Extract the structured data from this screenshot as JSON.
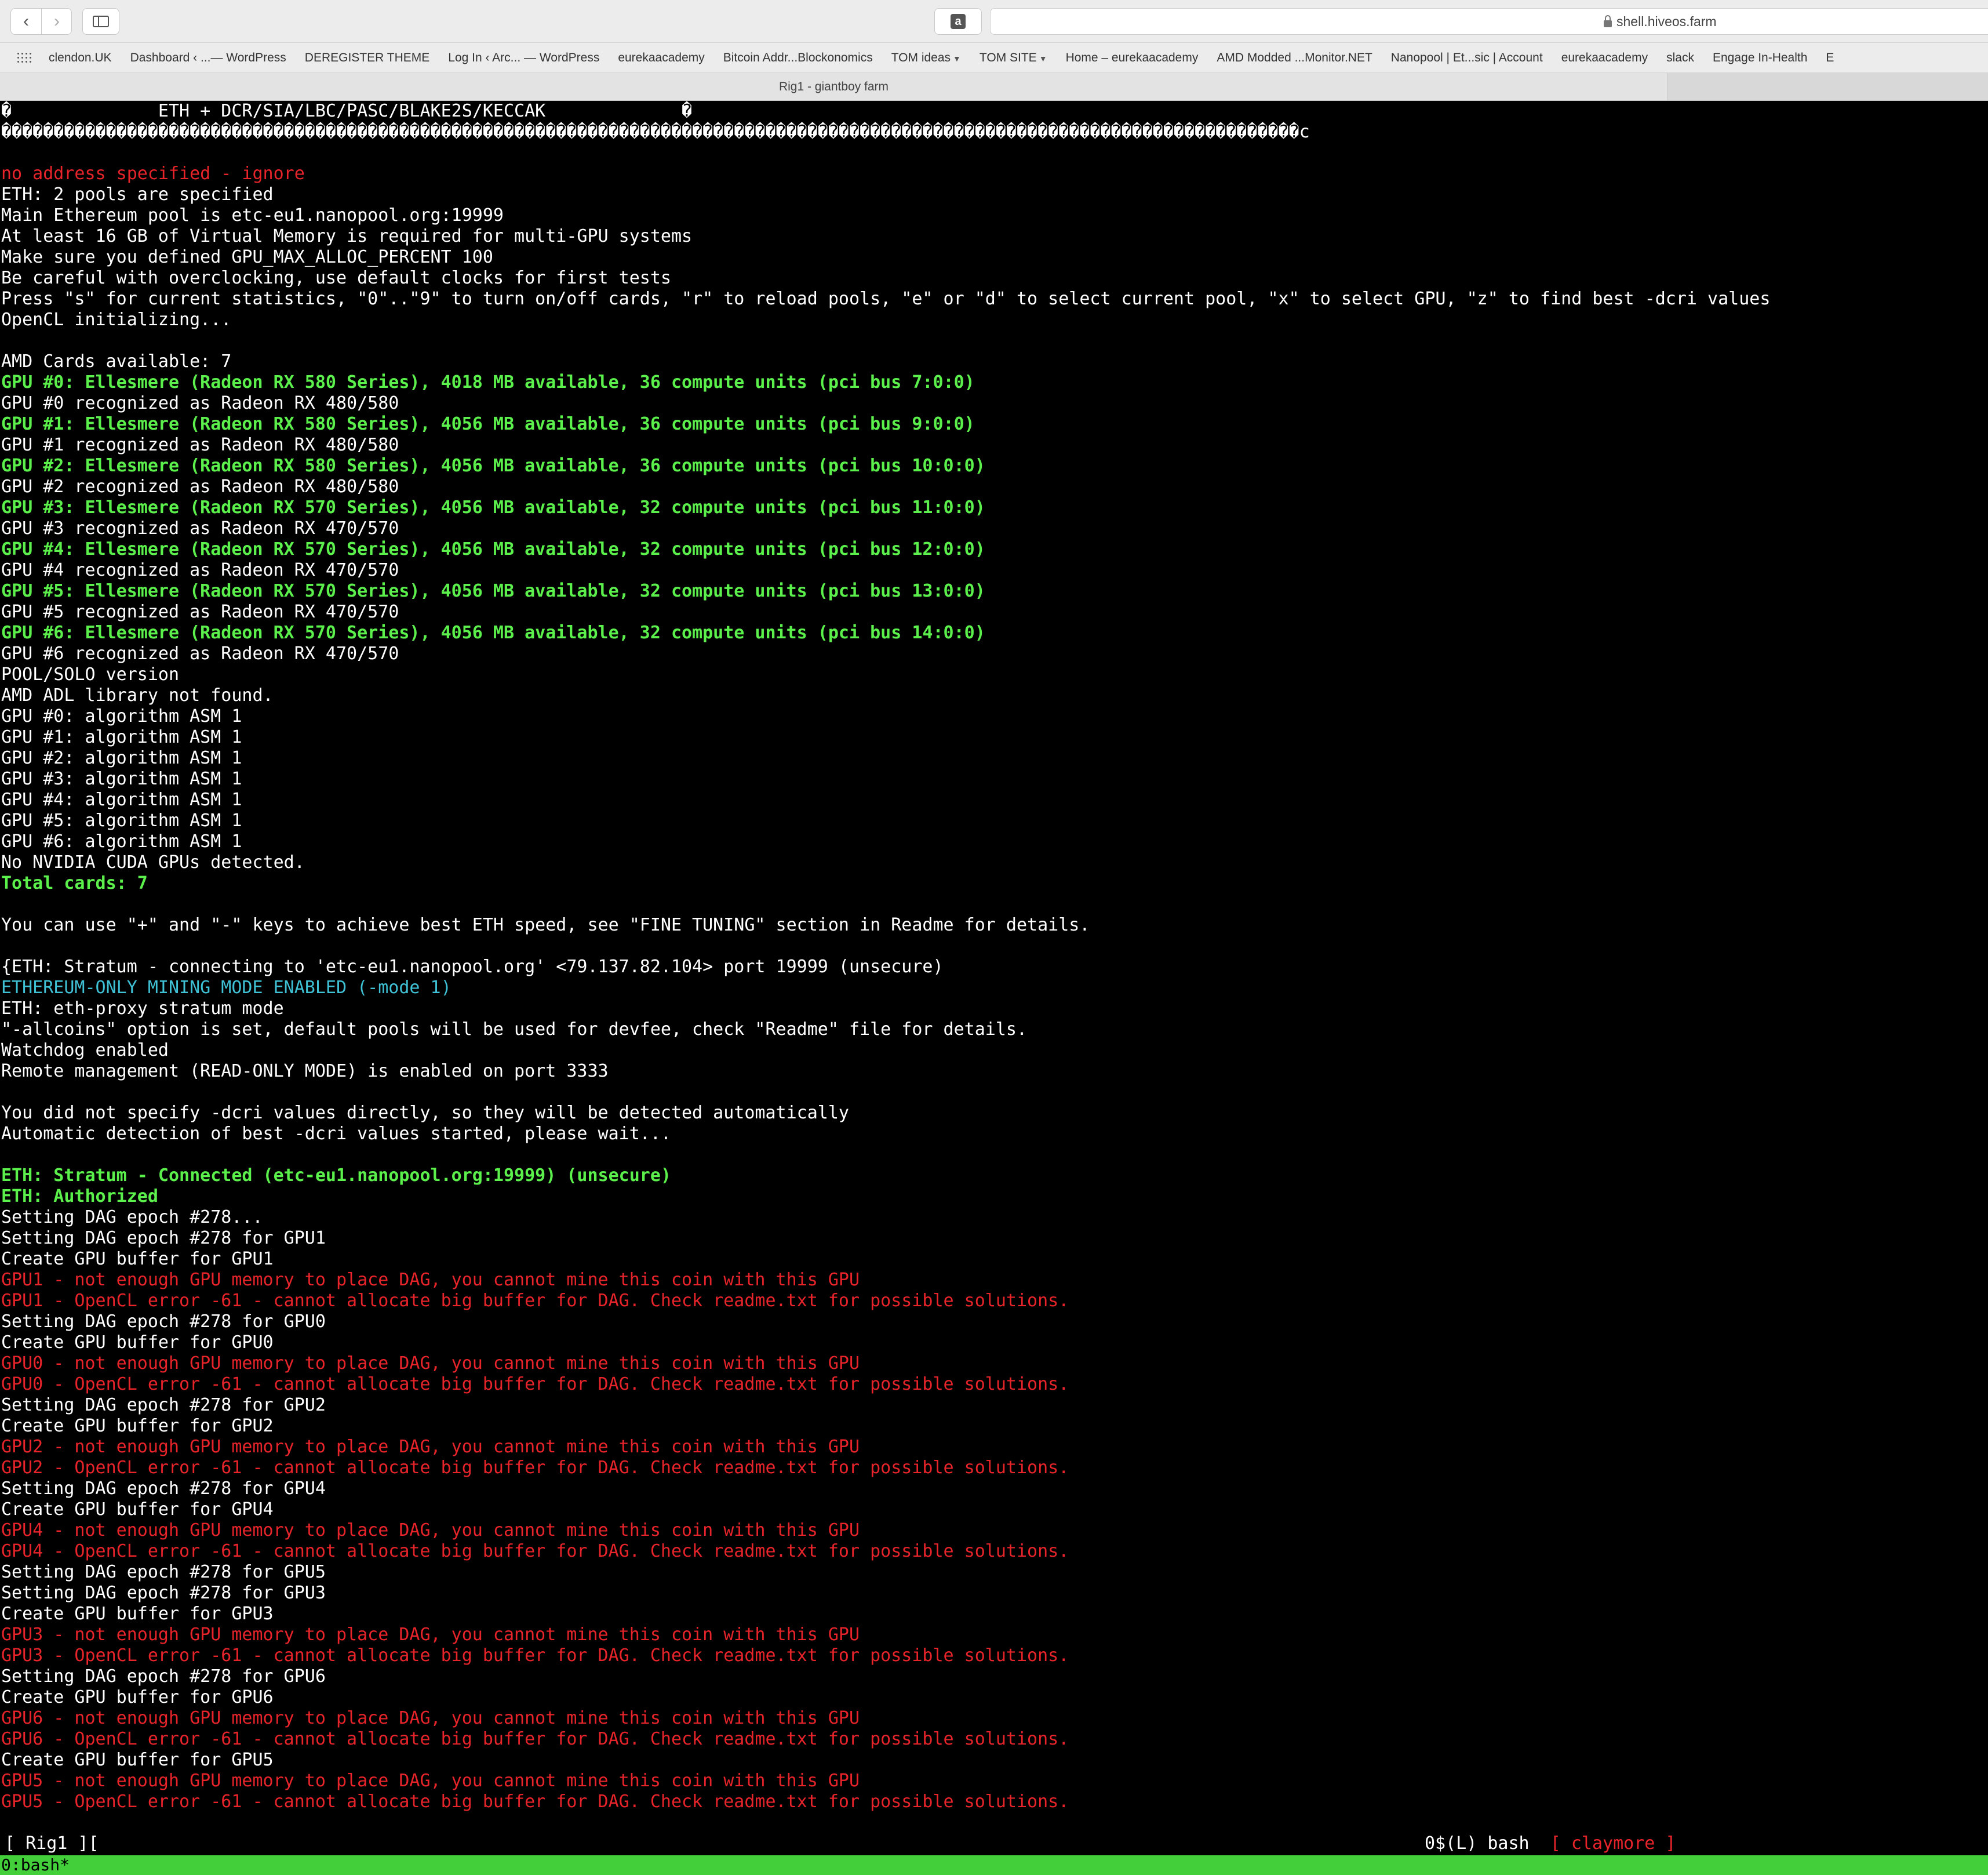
{
  "toolbar": {
    "back_glyph": "‹",
    "forward_glyph": "›",
    "extension_glyph": "a",
    "address": "shell.hiveos.farm"
  },
  "bookmarks": [
    "clendon.UK",
    "Dashboard ‹ ...— WordPress",
    "DEREGISTER THEME",
    "Log In ‹ Arc... — WordPress",
    "eurekaacademy",
    "Bitcoin Addr...Blockonomics",
    "TOM ideas",
    "TOM SITE",
    "Home – eurekaacademy",
    "AMD Modded ...Monitor.NET",
    "Nanopool | Et...sic | Account",
    "eurekaacademy",
    "slack",
    "Engage In-Health",
    "E"
  ],
  "tab": {
    "title": "Rig1 - giantboy farm"
  },
  "colors": {
    "terminal_bg": "#000000",
    "text_white": "#ffffff",
    "text_red": "#e8242b",
    "text_green": "#5cf04c",
    "text_cyan": "#3fc2d6",
    "tmux_bar": "#42cf3a"
  },
  "icons": {
    "back": "chevron-left-icon",
    "forward": "chevron-right-icon",
    "sidebar": "sidebar-icon",
    "extension": "amazon-icon",
    "lock": "lock-icon",
    "apps": "grid-icon",
    "dropdown": "chevron-down-icon"
  },
  "terminal": {
    "lines": [
      {
        "c": "white",
        "t": "�              ETH + DCR/SIA/LBC/PASC/BLAKE2S/KECCAK             �"
      },
      {
        "c": "white",
        "t": "����������������������������������������������������������������������������������������������������������������������������c"
      },
      {
        "c": "white",
        "t": ""
      },
      {
        "c": "red",
        "t": "no address specified - ignore"
      },
      {
        "c": "white",
        "t": "ETH: 2 pools are specified"
      },
      {
        "c": "white",
        "t": "Main Ethereum pool is etc-eu1.nanopool.org:19999"
      },
      {
        "c": "white",
        "t": "At least 16 GB of Virtual Memory is required for multi-GPU systems"
      },
      {
        "c": "white",
        "t": "Make sure you defined GPU_MAX_ALLOC_PERCENT 100"
      },
      {
        "c": "white",
        "t": "Be careful with overclocking, use default clocks for first tests"
      },
      {
        "c": "white",
        "t": "Press \"s\" for current statistics, \"0\"..\"9\" to turn on/off cards, \"r\" to reload pools, \"e\" or \"d\" to select current pool, \"x\" to select GPU, \"z\" to find best -dcri values"
      },
      {
        "c": "white",
        "t": "OpenCL initializing..."
      },
      {
        "c": "white",
        "t": ""
      },
      {
        "c": "white",
        "t": "AMD Cards available: 7"
      },
      {
        "c": "green",
        "t": "GPU #0: Ellesmere (Radeon RX 580 Series), 4018 MB available, 36 compute units (pci bus 7:0:0)"
      },
      {
        "c": "white",
        "t": "GPU #0 recognized as Radeon RX 480/580"
      },
      {
        "c": "green",
        "t": "GPU #1: Ellesmere (Radeon RX 580 Series), 4056 MB available, 36 compute units (pci bus 9:0:0)"
      },
      {
        "c": "white",
        "t": "GPU #1 recognized as Radeon RX 480/580"
      },
      {
        "c": "green",
        "t": "GPU #2: Ellesmere (Radeon RX 580 Series), 4056 MB available, 36 compute units (pci bus 10:0:0)"
      },
      {
        "c": "white",
        "t": "GPU #2 recognized as Radeon RX 480/580"
      },
      {
        "c": "green",
        "t": "GPU #3: Ellesmere (Radeon RX 570 Series), 4056 MB available, 32 compute units (pci bus 11:0:0)"
      },
      {
        "c": "white",
        "t": "GPU #3 recognized as Radeon RX 470/570"
      },
      {
        "c": "green",
        "t": "GPU #4: Ellesmere (Radeon RX 570 Series), 4056 MB available, 32 compute units (pci bus 12:0:0)"
      },
      {
        "c": "white",
        "t": "GPU #4 recognized as Radeon RX 470/570"
      },
      {
        "c": "green",
        "t": "GPU #5: Ellesmere (Radeon RX 570 Series), 4056 MB available, 32 compute units (pci bus 13:0:0)"
      },
      {
        "c": "white",
        "t": "GPU #5 recognized as Radeon RX 470/570"
      },
      {
        "c": "green",
        "t": "GPU #6: Ellesmere (Radeon RX 570 Series), 4056 MB available, 32 compute units (pci bus 14:0:0)"
      },
      {
        "c": "white",
        "t": "GPU #6 recognized as Radeon RX 470/570"
      },
      {
        "c": "white",
        "t": "POOL/SOLO version"
      },
      {
        "c": "white",
        "t": "AMD ADL library not found."
      },
      {
        "c": "white",
        "t": "GPU #0: algorithm ASM 1"
      },
      {
        "c": "white",
        "t": "GPU #1: algorithm ASM 1"
      },
      {
        "c": "white",
        "t": "GPU #2: algorithm ASM 1"
      },
      {
        "c": "white",
        "t": "GPU #3: algorithm ASM 1"
      },
      {
        "c": "white",
        "t": "GPU #4: algorithm ASM 1"
      },
      {
        "c": "white",
        "t": "GPU #5: algorithm ASM 1"
      },
      {
        "c": "white",
        "t": "GPU #6: algorithm ASM 1"
      },
      {
        "c": "white",
        "t": "No NVIDIA CUDA GPUs detected."
      },
      {
        "c": "green",
        "t": "Total cards: 7"
      },
      {
        "c": "white",
        "t": ""
      },
      {
        "c": "white",
        "t": "You can use \"+\" and \"-\" keys to achieve best ETH speed, see \"FINE TUNING\" section in Readme for details."
      },
      {
        "c": "white",
        "t": ""
      },
      {
        "c": "white",
        "t": "{ETH: Stratum - connecting to 'etc-eu1.nanopool.org' <79.137.82.104> port 19999 (unsecure)"
      },
      {
        "c": "cyan",
        "t": "ETHEREUM-ONLY MINING MODE ENABLED (-mode 1)"
      },
      {
        "c": "white",
        "t": "ETH: eth-proxy stratum mode"
      },
      {
        "c": "white",
        "t": "\"-allcoins\" option is set, default pools will be used for devfee, check \"Readme\" file for details."
      },
      {
        "c": "white",
        "t": "Watchdog enabled"
      },
      {
        "c": "white",
        "t": "Remote management (READ-ONLY MODE) is enabled on port 3333"
      },
      {
        "c": "white",
        "t": ""
      },
      {
        "c": "white",
        "t": "You did not specify -dcri values directly, so they will be detected automatically"
      },
      {
        "c": "white",
        "t": "Automatic detection of best -dcri values started, please wait..."
      },
      {
        "c": "white",
        "t": ""
      },
      {
        "c": "green",
        "t": "ETH: Stratum - Connected (etc-eu1.nanopool.org:19999) (unsecure)"
      },
      {
        "c": "green",
        "t": "ETH: Authorized"
      },
      {
        "c": "white",
        "t": "Setting DAG epoch #278..."
      },
      {
        "c": "white",
        "t": "Setting DAG epoch #278 for GPU1"
      },
      {
        "c": "white",
        "t": "Create GPU buffer for GPU1"
      },
      {
        "c": "red",
        "t": "GPU1 - not enough GPU memory to place DAG, you cannot mine this coin with this GPU"
      },
      {
        "c": "red",
        "t": "GPU1 - OpenCL error -61 - cannot allocate big buffer for DAG. Check readme.txt for possible solutions."
      },
      {
        "c": "white",
        "t": "Setting DAG epoch #278 for GPU0"
      },
      {
        "c": "white",
        "t": "Create GPU buffer for GPU0"
      },
      {
        "c": "red",
        "t": "GPU0 - not enough GPU memory to place DAG, you cannot mine this coin with this GPU"
      },
      {
        "c": "red",
        "t": "GPU0 - OpenCL error -61 - cannot allocate big buffer for DAG. Check readme.txt for possible solutions."
      },
      {
        "c": "white",
        "t": "Setting DAG epoch #278 for GPU2"
      },
      {
        "c": "white",
        "t": "Create GPU buffer for GPU2"
      },
      {
        "c": "red",
        "t": "GPU2 - not enough GPU memory to place DAG, you cannot mine this coin with this GPU"
      },
      {
        "c": "red",
        "t": "GPU2 - OpenCL error -61 - cannot allocate big buffer for DAG. Check readme.txt for possible solutions."
      },
      {
        "c": "white",
        "t": "Setting DAG epoch #278 for GPU4"
      },
      {
        "c": "white",
        "t": "Create GPU buffer for GPU4"
      },
      {
        "c": "red",
        "t": "GPU4 - not enough GPU memory to place DAG, you cannot mine this coin with this GPU"
      },
      {
        "c": "red",
        "t": "GPU4 - OpenCL error -61 - cannot allocate big buffer for DAG. Check readme.txt for possible solutions."
      },
      {
        "c": "white",
        "t": "Setting DAG epoch #278 for GPU5"
      },
      {
        "c": "white",
        "t": "Setting DAG epoch #278 for GPU3"
      },
      {
        "c": "white",
        "t": "Create GPU buffer for GPU3"
      },
      {
        "c": "red",
        "t": "GPU3 - not enough GPU memory to place DAG, you cannot mine this coin with this GPU"
      },
      {
        "c": "red",
        "t": "GPU3 - OpenCL error -61 - cannot allocate big buffer for DAG. Check readme.txt for possible solutions."
      },
      {
        "c": "white",
        "t": "Setting DAG epoch #278 for GPU6"
      },
      {
        "c": "white",
        "t": "Create GPU buffer for GPU6"
      },
      {
        "c": "red",
        "t": "GPU6 - not enough GPU memory to place DAG, you cannot mine this coin with this GPU"
      },
      {
        "c": "red",
        "t": "GPU6 - OpenCL error -61 - cannot allocate big buffer for DAG. Check readme.txt for possible solutions."
      },
      {
        "c": "white",
        "t": "Create GPU buffer for GPU5"
      },
      {
        "c": "red",
        "t": "GPU5 - not enough GPU memory to place DAG, you cannot mine this coin with this GPU"
      },
      {
        "c": "red",
        "t": "GPU5 - OpenCL error -61 - cannot allocate big buffer for DAG. Check readme.txt for possible solutions."
      }
    ]
  },
  "status_bar": {
    "left": "[ Rig1 ][",
    "right_main": "0$(L) bash",
    "right_highlight": "[ claymore ]"
  },
  "tmux": {
    "window": "0:bash*"
  }
}
